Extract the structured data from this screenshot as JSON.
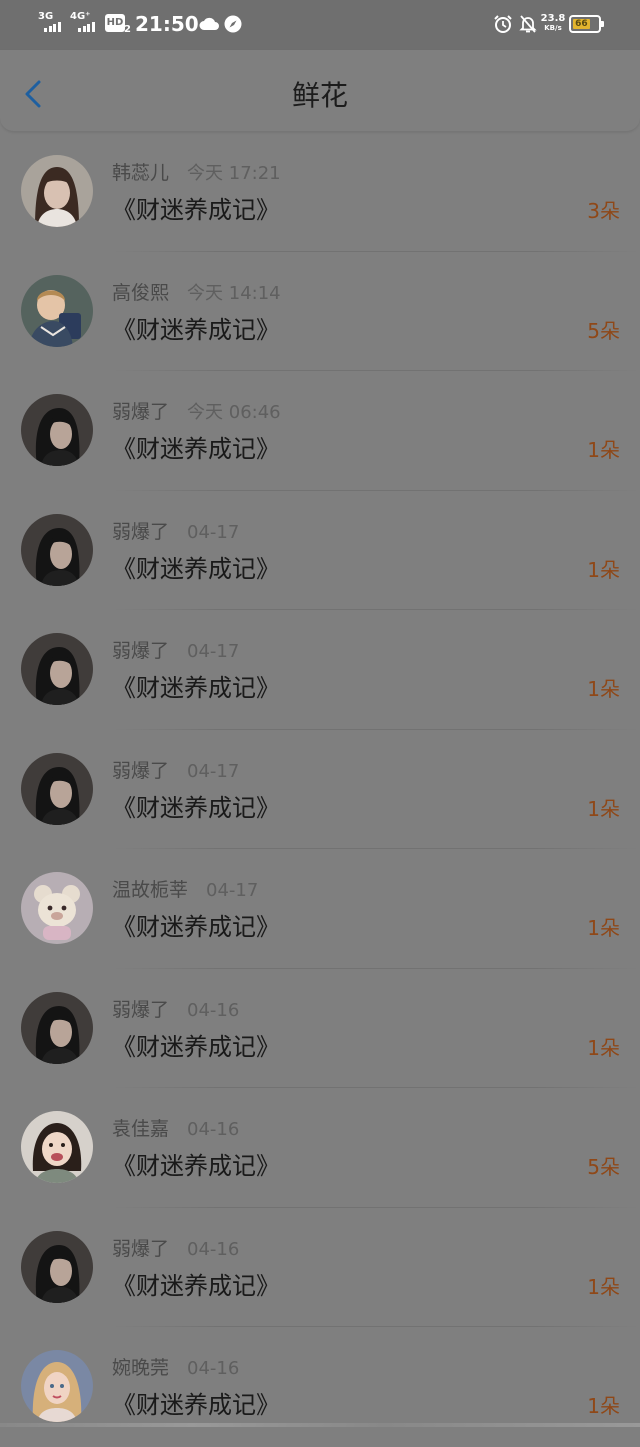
{
  "status_bar": {
    "network_1": "3G",
    "network_2": "4G⁺",
    "hd_label": "HD",
    "hd_sub": "2",
    "time": "21:50",
    "speed_value": "23.8",
    "speed_unit": "KB/s",
    "battery_level": "66",
    "icons": [
      "cloud-icon",
      "compass-icon",
      "alarm-clock-icon",
      "notifications-off-icon",
      "battery-icon"
    ]
  },
  "header": {
    "title": "鲜花",
    "back_icon": "chevron-left-icon"
  },
  "colors": {
    "overlay_gray": "#7f7f7f",
    "flower_count": "#8f4818",
    "back_arrow": "#1e5fa0"
  },
  "gifts": [
    {
      "user": "韩蕊儿",
      "time": "今天 17:21",
      "book": "《财迷养成记》",
      "count": "3朵",
      "avatar": "woman-portrait"
    },
    {
      "user": "高俊熙",
      "time": "今天 14:14",
      "book": "《财迷养成记》",
      "count": "5朵",
      "avatar": "boy-cartoon"
    },
    {
      "user": "弱爆了",
      "time": "今天 06:46",
      "book": "《财迷养成记》",
      "count": "1朵",
      "avatar": "man-dark-hair"
    },
    {
      "user": "弱爆了",
      "time": "04-17",
      "book": "《财迷养成记》",
      "count": "1朵",
      "avatar": "man-dark-hair"
    },
    {
      "user": "弱爆了",
      "time": "04-17",
      "book": "《财迷养成记》",
      "count": "1朵",
      "avatar": "man-dark-hair"
    },
    {
      "user": "弱爆了",
      "time": "04-17",
      "book": "《财迷养成记》",
      "count": "1朵",
      "avatar": "man-dark-hair"
    },
    {
      "user": "温故栀莘",
      "time": "04-17",
      "book": "《财迷养成记》",
      "count": "1朵",
      "avatar": "plush-bear"
    },
    {
      "user": "弱爆了",
      "time": "04-16",
      "book": "《财迷养成记》",
      "count": "1朵",
      "avatar": "man-dark-hair"
    },
    {
      "user": "袁佳嘉",
      "time": "04-16",
      "book": "《财迷养成记》",
      "count": "5朵",
      "avatar": "girl-smiling"
    },
    {
      "user": "弱爆了",
      "time": "04-16",
      "book": "《财迷养成记》",
      "count": "1朵",
      "avatar": "man-dark-hair"
    },
    {
      "user": "婉晚莞",
      "time": "04-16",
      "book": "《财迷养成记》",
      "count": "1朵",
      "avatar": "blonde-woman"
    }
  ]
}
